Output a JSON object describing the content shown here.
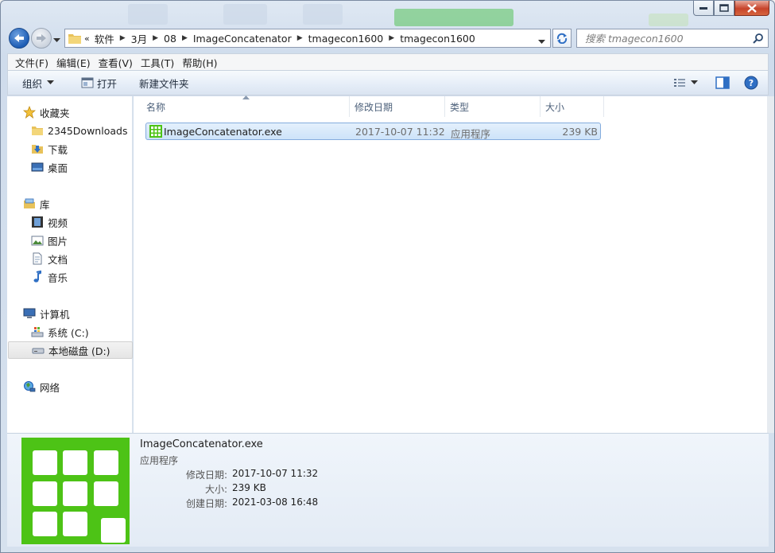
{
  "window": {
    "controls": {
      "minimize": "minimize",
      "maximize": "maximize",
      "close": "close"
    }
  },
  "address": {
    "overflow": "«",
    "crumbs": [
      "软件",
      "3月",
      "08",
      "ImageConcatenator",
      "tmagecon1600",
      "tmagecon1600"
    ]
  },
  "search": {
    "placeholder": "搜索 tmagecon1600"
  },
  "menu": [
    "文件(F)",
    "编辑(E)",
    "查看(V)",
    "工具(T)",
    "帮助(H)"
  ],
  "commands": {
    "organize": "组织",
    "open": "打开",
    "new_folder": "新建文件夹"
  },
  "nav": {
    "favorites": "收藏夹",
    "fav_items": [
      "2345Downloads",
      "下载",
      "桌面"
    ],
    "libraries": "库",
    "lib_items": [
      "视频",
      "图片",
      "文档",
      "音乐"
    ],
    "computer": "计算机",
    "drives": [
      "系统 (C:)",
      "本地磁盘 (D:)"
    ],
    "network": "网络"
  },
  "columns": [
    "名称",
    "修改日期",
    "类型",
    "大小"
  ],
  "files": [
    {
      "name": "ImageConcatenator.exe",
      "modified": "2017-10-07 11:32",
      "type": "应用程序",
      "size": "239 KB"
    }
  ],
  "details": {
    "name": "ImageConcatenator.exe",
    "type": "应用程序",
    "modified_label": "修改日期:",
    "modified": "2017-10-07 11:32",
    "size_label": "大小:",
    "size": "239 KB",
    "created_label": "创建日期:",
    "created": "2021-03-08 16:48"
  },
  "colors": {
    "app_icon_green": "#4dc316",
    "selection": "#cde3f9",
    "accent": "#1d5db5"
  }
}
